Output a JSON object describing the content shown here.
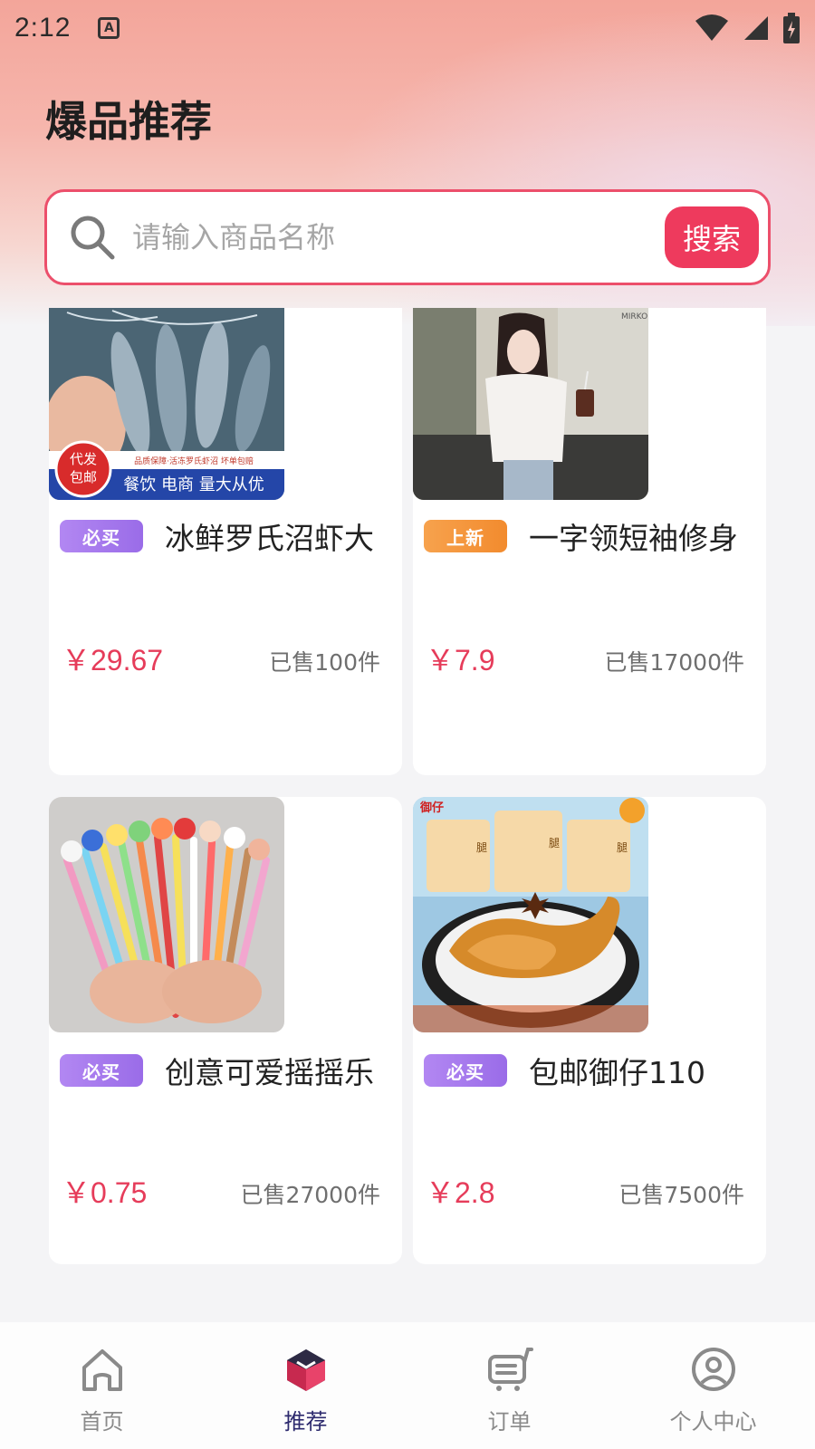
{
  "status": {
    "time": "2:12",
    "a_icon_label": "A"
  },
  "header": {
    "title": "爆品推荐"
  },
  "search": {
    "placeholder": "请输入商品名称",
    "value": "",
    "button_label": "搜索"
  },
  "products": [
    {
      "badge": "必买",
      "badge_color": "#a77aee",
      "title": "冰鲜罗氏沼虾大",
      "price": "￥29.67",
      "sold": "已售100件",
      "image_text": {
        "circle": "代发\n包邮",
        "top_strip": "品质保障·活冻罗氏虾沼 坏单包赔",
        "bottom_strip": "餐饮 电商 量大从优"
      }
    },
    {
      "badge": "上新",
      "badge_color": "#f39a40",
      "title": "一字领短袖修身",
      "price": "￥7.9",
      "sold": "已售17000件",
      "image_text": {
        "sign": "MIRKO"
      }
    },
    {
      "badge": "必买",
      "badge_color": "#a77aee",
      "title": "创意可爱摇摇乐",
      "price": "￥0.75",
      "sold": "已售27000件"
    },
    {
      "badge": "必买",
      "badge_color": "#a77aee",
      "title": "包邮御仔110",
      "price": "￥2.8",
      "sold": "已售7500件",
      "image_text": {
        "brand": "御仔",
        "pack": "腿"
      }
    }
  ],
  "tabs": [
    {
      "label": "首页",
      "icon": "home-icon",
      "active": false
    },
    {
      "label": "推荐",
      "icon": "cube-icon",
      "active": true
    },
    {
      "label": "订单",
      "icon": "cart-icon",
      "active": false
    },
    {
      "label": "个人中心",
      "icon": "user-circle-icon",
      "active": false
    }
  ]
}
